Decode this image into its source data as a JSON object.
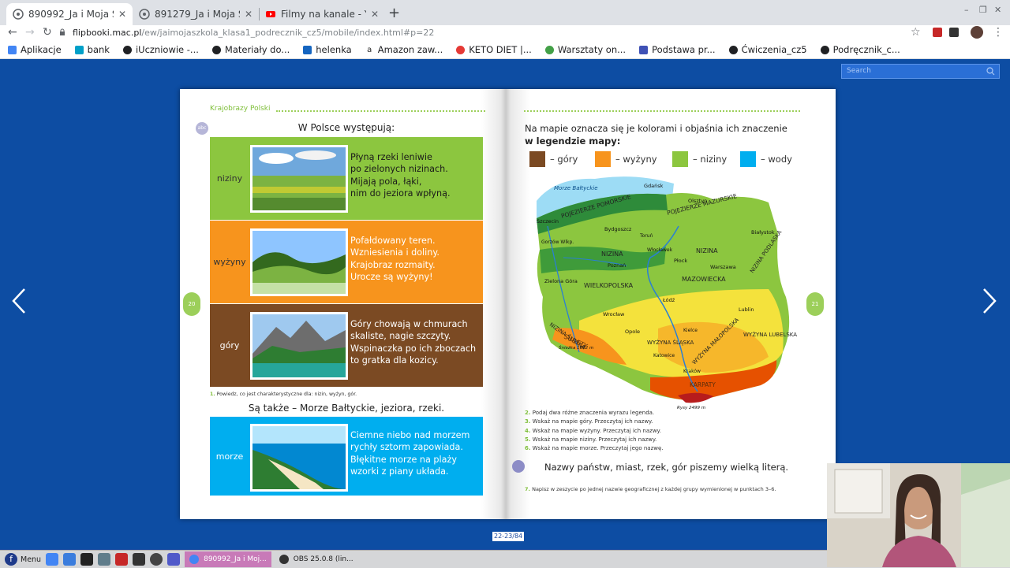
{
  "browser": {
    "tabs": [
      {
        "title": "890992_Ja i Moja Szkoła",
        "active": true,
        "favicon": "chrome-globe-icon"
      },
      {
        "title": "891279_Ja i Moja Szkoła",
        "active": false,
        "favicon": "chrome-globe-icon"
      },
      {
        "title": "Filmy na kanale - YouTube",
        "active": false,
        "favicon": "youtube-icon"
      }
    ],
    "url_domain": "flipbooki.mac.pl",
    "url_path": "/ew/jaimojaszkola_klasa1_podrecznik_cz5/mobile/index.html#p=22",
    "bookmarks": [
      {
        "label": "Aplikacje",
        "icon": "apps-icon",
        "color": "#4285f4"
      },
      {
        "label": "bank",
        "icon": "bank-icon",
        "color": "#00a0c8"
      },
      {
        "label": "iUczniowie -...",
        "icon": "globe-icon",
        "color": "#202124"
      },
      {
        "label": "Materiały do...",
        "icon": "globe-icon",
        "color": "#202124"
      },
      {
        "label": "helenka",
        "icon": "bookmark-icon",
        "color": "#1565c0"
      },
      {
        "label": "Amazon zaw...",
        "icon": "amazon-icon",
        "color": "#222222"
      },
      {
        "label": "KETO DIET |...",
        "icon": "keto-icon",
        "color": "#e53935"
      },
      {
        "label": "Warsztaty on...",
        "icon": "warsztaty-icon",
        "color": "#43a047"
      },
      {
        "label": "Podstawa pr...",
        "icon": "doc-icon",
        "color": "#3f51b5"
      },
      {
        "label": "Ćwiczenia_cz5",
        "icon": "globe-icon",
        "color": "#202124"
      },
      {
        "label": "Podręcznik_c...",
        "icon": "globe-icon",
        "color": "#202124"
      }
    ]
  },
  "viewer": {
    "search_placeholder": "Search",
    "page_counter": "22-23/84"
  },
  "left_page": {
    "header": "Krajobrazy Polski",
    "abc_badge": "abc",
    "intro": "W Polsce występują:",
    "page_number": "20",
    "rows": [
      {
        "label": "niziny",
        "color": "#8cc63f",
        "text_color": "#1a1a1a",
        "lines": [
          "Płyną rzeki leniwie",
          "po zielonych nizinach.",
          "Mijają pola, łąki,",
          "nim do jeziora wpłyną."
        ]
      },
      {
        "label": "wyżyny",
        "color": "#f7941d",
        "text_color": "#ffffff",
        "lines": [
          "Pofałdowany teren.",
          "Wzniesienia i doliny.",
          "Krajobraz rozmaity.",
          "Urocze są wyżyny!"
        ]
      },
      {
        "label": "góry",
        "color": "#7b4a23",
        "text_color": "#ffffff",
        "lines": [
          "Góry chowają w chmurach",
          "skaliste, nagie szczyty.",
          "Wspinaczka po ich zboczach",
          "to gratka dla kozicy."
        ]
      }
    ],
    "question1_num": "1.",
    "question1": "Powiedz, co jest charakterystyczne dla: nizin, wyżyn, gór.",
    "also": "Są także – Morze Bałtyckie, jeziora, rzeki.",
    "sea_row": {
      "label": "morze",
      "color": "#00aeef",
      "text_color": "#ffffff",
      "lines": [
        "Ciemne niebo nad morzem",
        "rychły sztorm zapowiada.",
        "Błękitne morze na plaży",
        "wzorki z piany układa."
      ]
    }
  },
  "right_page": {
    "intro_line1": "Na mapie oznacza się je kolorami i objaśnia ich znaczenie",
    "intro_line2": "w legendzie mapy",
    "intro_colon": ":",
    "page_number": "21",
    "legend": [
      {
        "label": "– góry",
        "color": "#7b4a23"
      },
      {
        "label": "– wyżyny",
        "color": "#f7941d"
      },
      {
        "label": "– niziny",
        "color": "#8cc63f"
      },
      {
        "label": "– wody",
        "color": "#00aeef"
      }
    ],
    "map_labels": {
      "sea": "Morze Bałtyckie",
      "gdansk": "Gdańsk",
      "pomorskie": "POJEZIERZE POMORSKIE",
      "mazurskie": "POJEZIERZE MAZURSKIE",
      "olsztyn": "Olsztyn",
      "szczecin": "Szczecin",
      "bydgoszcz": "Bydgoszcz",
      "torun": "Toruń",
      "wloclawek": "Włocławek",
      "bialystok": "Białystok",
      "gorzow": "Gorzów Wlkp.",
      "nizina1": "NIZINA",
      "nizina2": "NIZINA",
      "nizina_podlaska": "NIZINA PODLASKA",
      "poznan": "Poznań",
      "plock": "Płock",
      "warszawa": "Warszawa",
      "mazowiecka": "MAZOWIECKA",
      "zielona_gora": "Zielona Góra",
      "wielkopolska": "WIELKOPOLSKA",
      "lodz": "Łódź",
      "lublin": "Lublin",
      "nizina_slaska": "NIZINA ŚLĄSKA",
      "wroclaw": "Wrocław",
      "sudety": "SUDETY",
      "opole": "Opole",
      "wyzyna_slaska": "WYŻYNA ŚLĄSKA",
      "wyzyna_lubelska": "WYŻYNA LUBELSKA",
      "wyzyna_malopolska": "WYŻYNA MAŁOPOLSKA",
      "kielce": "Kielce",
      "katowice": "Katowice",
      "krakow": "Kraków",
      "karpaty": "KARPATY",
      "sniezka": "Śnieżka 1602 m",
      "rysy": "Rysy 2499 m"
    },
    "tasks": [
      {
        "num": "2.",
        "text": "Podaj dwa różne znaczenia wyrazu legenda."
      },
      {
        "num": "3.",
        "text": "Wskaż na mapie góry. Przeczytaj ich nazwy."
      },
      {
        "num": "4.",
        "text": "Wskaż na mapie wyżyny. Przeczytaj ich nazwy."
      },
      {
        "num": "5.",
        "text": "Wskaż na mapie niziny. Przeczytaj ich nazwy."
      },
      {
        "num": "6.",
        "text": "Wskaż na mapie morze. Przeczytaj jego nazwę."
      }
    ],
    "rule": "Nazwy państw, miast, rzek, gór piszemy wielką literą.",
    "question7_num": "7.",
    "question7": "Napisz w zeszycie po jednej nazwie geograficznej z każdej grupy wymienionej w punktach 3–6."
  },
  "taskbar": {
    "menu": "Menu",
    "apps": [
      {
        "label": "890992_Ja i Moj...",
        "icon": "chrome-icon",
        "active": true
      },
      {
        "label": "OBS 25.0.8 (lin...",
        "icon": "obs-icon",
        "active": false
      }
    ]
  },
  "webcam": {
    "alt": "webcam-overlay"
  }
}
